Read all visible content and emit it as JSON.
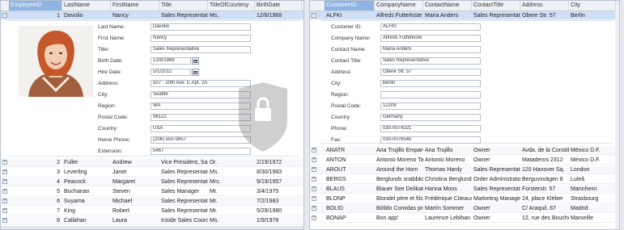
{
  "left_grid": {
    "headers": [
      "EmployeeID",
      "LastName",
      "FirstName",
      "Title",
      "TitleOfCourtesy",
      "BirthDate"
    ],
    "first_row": [
      "1",
      "Davolio",
      "Nancy",
      "Sales Representativ",
      "Ms.",
      "12/8/1968"
    ],
    "detail": {
      "labels": {
        "last_name": "Last Name:",
        "first_name": "First Name:",
        "title": "Title:",
        "birth_date": "Birth Date:",
        "hire_date": "Hire Date:",
        "address": "Address:",
        "city": "City:",
        "region": "Region:",
        "postal_code": "Postal Code:",
        "country": "Country:",
        "home_phone": "Home Phone:",
        "extension": "Extension:"
      },
      "values": {
        "last_name": "Davolio",
        "first_name": "Nancy",
        "title": "Sales Representative",
        "birth_date": "12/8/1968",
        "hire_date": "5/1/2012",
        "address": "507 - 20th Ave. E.Apt. 2A",
        "city": "Seattle",
        "region": "WA",
        "postal_code": "98122",
        "country": "USA",
        "home_phone": "(206) 555-9857",
        "extension": "5467"
      }
    },
    "rows": [
      [
        "2",
        "Fuller",
        "Andrew",
        "Vice President, Sale",
        "Dr.",
        "2/19/1972"
      ],
      [
        "3",
        "Leverling",
        "Janet",
        "Sales Representativ",
        "Ms.",
        "8/30/1983"
      ],
      [
        "4",
        "Peacock",
        "Margaret",
        "Sales Representativ",
        "Mrs.",
        "9/19/1957"
      ],
      [
        "5",
        "Buchanan",
        "Steven",
        "Sales Manager",
        "Mr.",
        "3/4/1975"
      ],
      [
        "6",
        "Suyama",
        "Michael",
        "Sales Representativ",
        "Mr.",
        "7/2/1983"
      ],
      [
        "7",
        "King",
        "Robert",
        "Sales Representativ",
        "Mr.",
        "5/29/1980"
      ],
      [
        "8",
        "Callahan",
        "Laura",
        "Inside Sales Coordi",
        "Ms.",
        "1/9/1978"
      ]
    ]
  },
  "right_grid": {
    "headers": [
      "CustomerID",
      "CompanyName",
      "ContactName",
      "ContactTitle",
      "Address",
      "City"
    ],
    "first_row": [
      "ALFKI",
      "Alfreds Futterkiste",
      "Maria Anders",
      "Sales Representativ",
      "Obere Str. 57",
      "Berlin"
    ],
    "detail": {
      "labels": {
        "customer_id": "Customer ID:",
        "company_name": "Company Name:",
        "contact_name": "Contact Name:",
        "contact_title": "Contact Title:",
        "address": "Address:",
        "city": "City:",
        "region": "Region:",
        "postal_code": "Postal Code:",
        "country": "Country:",
        "phone": "Phone:",
        "fax": "Fax:"
      },
      "values": {
        "customer_id": "ALFKI",
        "company_name": "Alfreds Futterkiste",
        "contact_name": "Maria Anders",
        "contact_title": "Sales Representative",
        "address": "Obere Str. 57",
        "city": "Berlin",
        "region": "",
        "postal_code": "12209",
        "country": "Germany",
        "phone": "030-0074321",
        "fax": "030-0076545"
      }
    },
    "rows": [
      [
        "ANATR",
        "Ana Trujillo Empare",
        "Ana Trujillo",
        "Owner",
        "Avda. de la Constit.",
        "México D.F."
      ],
      [
        "ANTON",
        "Antonio Moreno Ta",
        "Antonio Moreno",
        "Owner",
        "Mataderos  2312",
        "México D.F."
      ],
      [
        "AROUT",
        "Around the Horn",
        "Thomas Hardy",
        "Sales Representativ",
        "120 Hanover Sq.",
        "London"
      ],
      [
        "BERGS",
        "Berglunds snabbköp",
        "Christina Berglund",
        "Order Administrato",
        "Berguvsvägen  8",
        "Luleå"
      ],
      [
        "BLAUS",
        "Blauer See Delikate",
        "Hanna Moos",
        "Sales Representativ",
        "Forsterstr. 57",
        "Mannheim"
      ],
      [
        "BLONP",
        "Blondel père et fils",
        "Frédérique Citeaux",
        "Marketing Manager",
        "24, place Kléber",
        "Strasbourg"
      ],
      [
        "BOLID",
        "Bólido Comidas pre",
        "Martín Sommer",
        "Owner",
        "C/ Araquil, 67",
        "Madrid"
      ],
      [
        "BONAP",
        "Bon app'",
        "Laurence Lebihan",
        "Owner",
        "12, rue des Bouchers",
        "Marseille"
      ]
    ]
  },
  "icons": {
    "expand": "+",
    "collapse": "−"
  },
  "colors": {
    "header_selected": "#8fb3e3",
    "row_selected": "#cfe0f6"
  }
}
